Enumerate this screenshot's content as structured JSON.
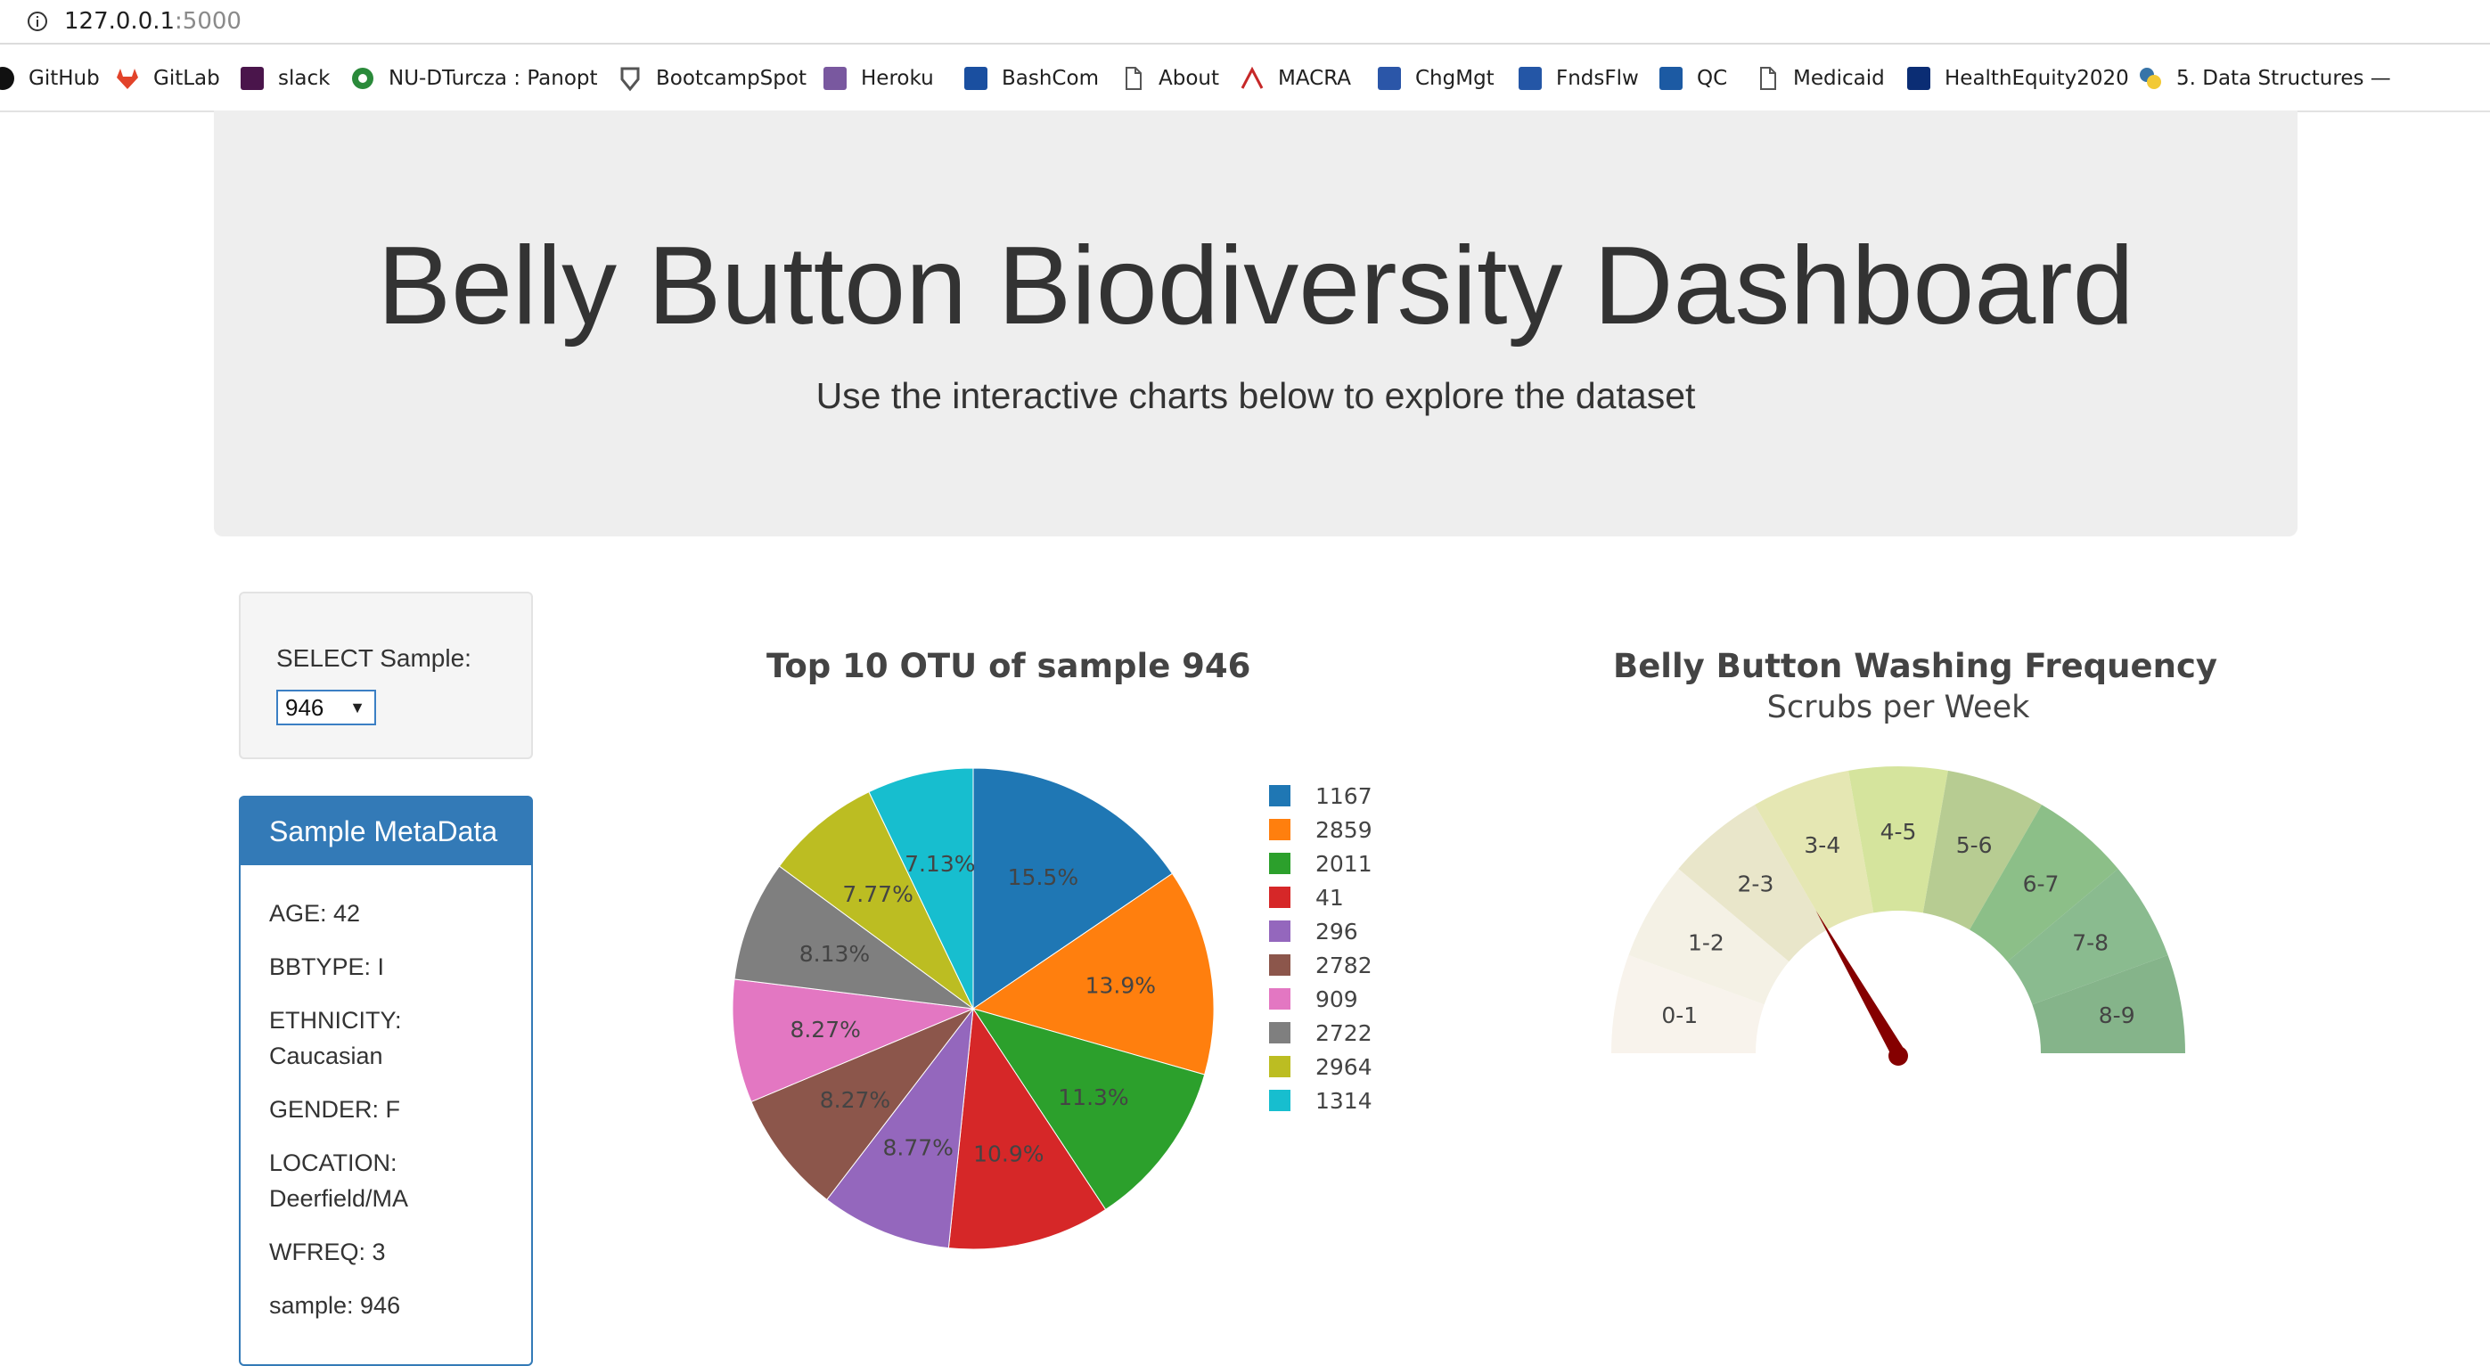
{
  "browser": {
    "url_host": "127.0.0.1",
    "url_port": ":5000",
    "bookmarks": [
      {
        "label": "GitHub",
        "icon": "github-icon"
      },
      {
        "label": "GitLab",
        "icon": "gitlab-icon"
      },
      {
        "label": "slack",
        "icon": "slack-icon"
      },
      {
        "label": "NU-DTurcza : Panopt",
        "icon": "panopto-icon"
      },
      {
        "label": "BootcampSpot",
        "icon": "bootcampspot-icon"
      },
      {
        "label": "Heroku",
        "icon": "heroku-icon"
      },
      {
        "label": "BashCom",
        "icon": "bashcom-icon"
      },
      {
        "label": "About",
        "icon": "page-icon"
      },
      {
        "label": "MACRA",
        "icon": "macra-icon"
      },
      {
        "label": "ChgMgt",
        "icon": "chgmgt-icon"
      },
      {
        "label": "FndsFlw",
        "icon": "dhg-icon"
      },
      {
        "label": "QC",
        "icon": "qc-icon"
      },
      {
        "label": "Medicaid",
        "icon": "page-icon"
      },
      {
        "label": "HealthEquity2020",
        "icon": "healthequity-icon"
      },
      {
        "label": "5. Data Structures —",
        "icon": "python-icon"
      }
    ]
  },
  "header": {
    "title": "Belly Button Biodiversity Dashboard",
    "subtitle": "Use the interactive charts below to explore the dataset"
  },
  "selector": {
    "label": "SELECT Sample:",
    "selected": "946"
  },
  "metadata": {
    "heading": "Sample MetaData",
    "items": [
      "AGE: 42",
      "BBTYPE: I",
      "ETHNICITY: Caucasian",
      "GENDER: F",
      "LOCATION: Deerfield/MA",
      "WFREQ: 3",
      "sample: 946"
    ]
  },
  "chart_data": [
    {
      "type": "pie",
      "title": "Top 10 OTU of sample 946",
      "legend_position": "right",
      "labels": [
        "1167",
        "2859",
        "2011",
        "41",
        "296",
        "2782",
        "909",
        "2722",
        "2964",
        "1314"
      ],
      "values": [
        15.5,
        13.9,
        11.3,
        10.9,
        8.77,
        8.27,
        8.27,
        8.13,
        7.77,
        7.13
      ],
      "value_labels": [
        "15.5%",
        "13.9%",
        "11.3%",
        "10.9%",
        "8.77%",
        "8.27%",
        "8.27%",
        "8.13%",
        "7.77%",
        "7.13%"
      ],
      "colors": [
        "#1f77b4",
        "#ff7f0e",
        "#2ca02c",
        "#d62728",
        "#9467bd",
        "#8c564b",
        "#e377c2",
        "#7f7f7f",
        "#bcbd22",
        "#17becf"
      ]
    },
    {
      "type": "gauge",
      "title": "Belly Button Washing Frequency",
      "subtitle": "Scrubs per Week",
      "value": 3,
      "range": [
        0,
        9
      ],
      "segment_labels": [
        "0-1",
        "1-2",
        "2-3",
        "3-4",
        "4-5",
        "5-6",
        "6-7",
        "7-8",
        "8-9"
      ],
      "segment_colors": [
        "#f8f3ec",
        "#f4f1e5",
        "#e9e6ca",
        "#e5e7b3",
        "#d5e49d",
        "#b7cc92",
        "#8cbf88",
        "#8abb8f",
        "#85b48a"
      ],
      "needle_color": "#850000"
    }
  ]
}
